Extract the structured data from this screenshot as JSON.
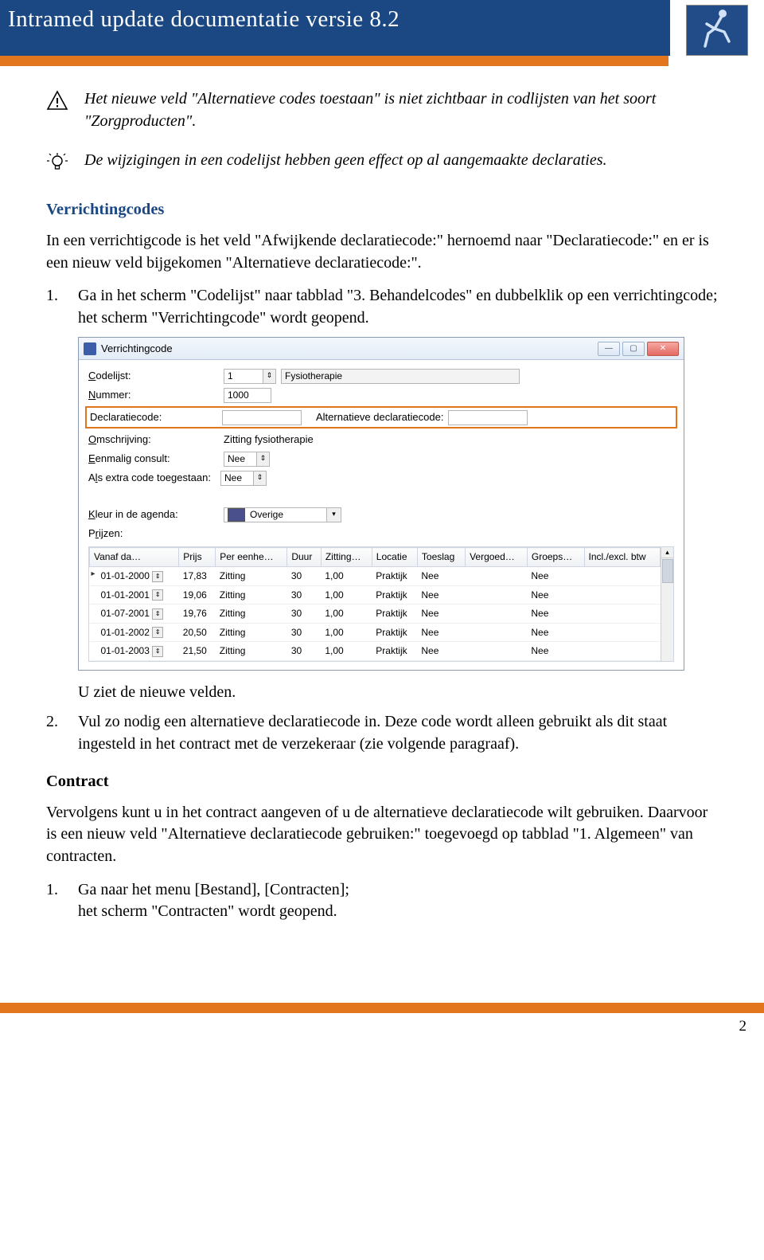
{
  "header": {
    "title": "Intramed update documentatie versie 8.2"
  },
  "notes": {
    "warning": "Het nieuwe veld \"Alternatieve codes toestaan\" is niet zichtbaar in codlijsten van het soort \"Zorgproducten\".",
    "tip": "De wijzigingen in een codelijst hebben geen effect op al aangemaakte declaraties."
  },
  "section_verrichtingcodes": {
    "heading": "Verrichtingcodes",
    "intro": "In een verrichtigcode is het veld \"Afwijkende declaratiecode:\" hernoemd naar \"Declaratiecode:\" en er is een nieuw veld bijgekomen \"Alternatieve declaratiecode:\".",
    "step1_num": "1.",
    "step1": "Ga in het scherm \"Codelijst\" naar tabblad \"3. Behandelcodes\" en dubbelklik op een verrichtingcode;\nhet scherm \"Verrichtingcode\" wordt geopend.",
    "after_img": "U ziet de nieuwe velden.",
    "step2_num": "2.",
    "step2": "Vul zo nodig een alternatieve declaratiecode in. Deze code wordt alleen gebruikt als dit staat ingesteld in het contract met de verzekeraar (zie volgende paragraaf)."
  },
  "dialog": {
    "title": "Verrichtingcode",
    "labels": {
      "codelijst": "Codelijst:",
      "nummer": "Nummer:",
      "declaratiecode": "Declaratiecode:",
      "alt_declaratiecode": "Alternatieve declaratiecode:",
      "omschrijving": "Omschrijving:",
      "eenmalig": "Eenmalig consult:",
      "als_extra": "Als extra code toegestaan:",
      "kleur_agenda": "Kleur in de agenda:",
      "prijzen": "Prijzen:"
    },
    "values": {
      "codelijst": "1",
      "codelijst_desc": "Fysiotherapie",
      "nummer": "1000",
      "omschrijving": "Zitting fysiotherapie",
      "eenmalig": "Nee",
      "als_extra": "Nee",
      "kleur_desc": "Overige"
    },
    "columns": [
      "Vanaf da…",
      "Prijs",
      "Per eenhe…",
      "Duur",
      "Zitting…",
      "Locatie",
      "Toeslag",
      "Vergoed…",
      "Groeps…",
      "Incl./excl. btw"
    ],
    "rows": [
      {
        "vanaf": "01-01-2000",
        "prijs": "17,83",
        "per": "Zitting",
        "duur": "30",
        "zit": "1,00",
        "loc": "Praktijk",
        "toe": "Nee",
        "ver": "",
        "grp": "Nee",
        "btw": ""
      },
      {
        "vanaf": "01-01-2001",
        "prijs": "19,06",
        "per": "Zitting",
        "duur": "30",
        "zit": "1,00",
        "loc": "Praktijk",
        "toe": "Nee",
        "ver": "",
        "grp": "Nee",
        "btw": ""
      },
      {
        "vanaf": "01-07-2001",
        "prijs": "19,76",
        "per": "Zitting",
        "duur": "30",
        "zit": "1,00",
        "loc": "Praktijk",
        "toe": "Nee",
        "ver": "",
        "grp": "Nee",
        "btw": ""
      },
      {
        "vanaf": "01-01-2002",
        "prijs": "20,50",
        "per": "Zitting",
        "duur": "30",
        "zit": "1,00",
        "loc": "Praktijk",
        "toe": "Nee",
        "ver": "",
        "grp": "Nee",
        "btw": ""
      },
      {
        "vanaf": "01-01-2003",
        "prijs": "21,50",
        "per": "Zitting",
        "duur": "30",
        "zit": "1,00",
        "loc": "Praktijk",
        "toe": "Nee",
        "ver": "",
        "grp": "Nee",
        "btw": ""
      }
    ]
  },
  "section_contract": {
    "heading": "Contract",
    "intro": "Vervolgens kunt u in het contract aangeven of u de alternatieve declaratiecode wilt gebruiken. Daarvoor is een nieuw veld \"Alternatieve declaratiecode gebruiken:\" toegevoegd op tabblad \"1. Algemeen\" van contracten.",
    "step1_num": "1.",
    "step1": "Ga naar het menu [Bestand], [Contracten];\nhet scherm \"Contracten\" wordt geopend."
  },
  "page_number": "2"
}
